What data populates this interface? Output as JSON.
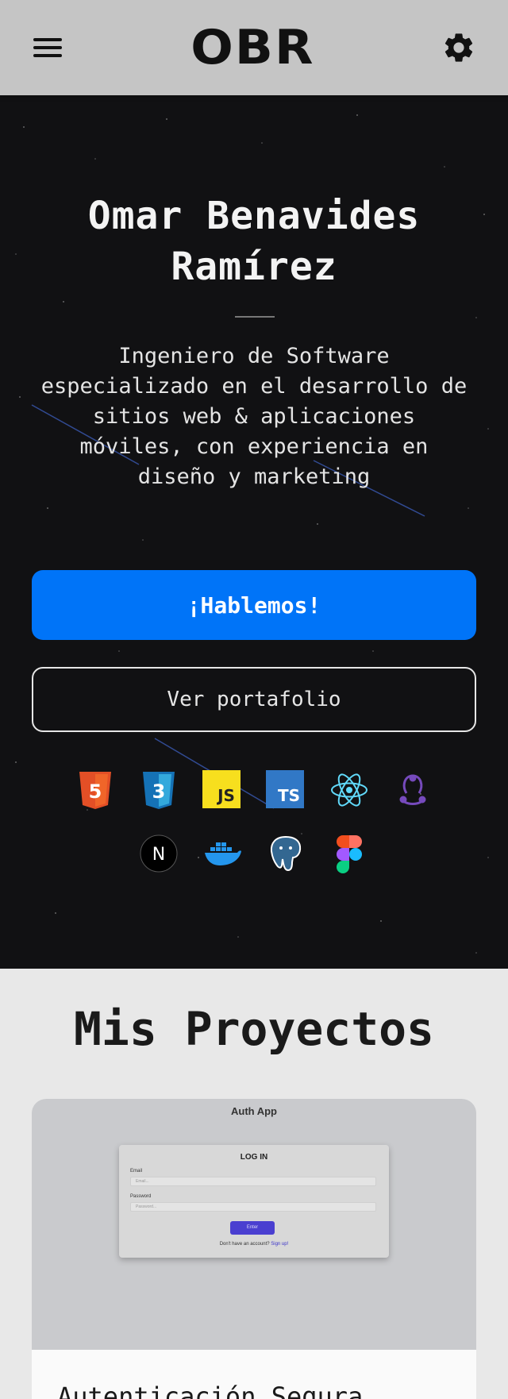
{
  "header": {
    "logo": "OBR",
    "menu_icon": "hamburger-menu-icon",
    "settings_icon": "gear-icon"
  },
  "hero": {
    "title": "Omar Benavides Ramírez",
    "subtitle": "Ingeniero de Software especializado en el desarrollo de sitios web & aplicaciones móviles, con experiencia en diseño y marketing",
    "cta_primary": "¡Hablemos!",
    "cta_secondary": "Ver portafolio",
    "tech_icons": {
      "html5": "HTML5",
      "css3": "CSS3",
      "js": "JS",
      "ts": "TS",
      "react": "react-icon",
      "redux": "redux-icon",
      "next": "N",
      "docker": "docker-icon",
      "postgres": "postgresql-icon",
      "figma": "figma-icon"
    }
  },
  "projects": {
    "heading": "Mis Proyectos",
    "cards": [
      {
        "thumbnail": {
          "app_title": "Auth App",
          "form_title": "LOG IN",
          "email_label": "Email",
          "email_placeholder": "Email...",
          "password_label": "Password",
          "password_placeholder": "Password...",
          "button": "Enter",
          "signup_text": "Don't have an account?",
          "signup_link": "Sign up!"
        },
        "title": "Autenticación Segura"
      }
    ]
  },
  "colors": {
    "accent": "#0074f8",
    "header_bg": "#c5c5c5",
    "hero_bg": "#111113",
    "page_bg": "#e8e8e8"
  }
}
